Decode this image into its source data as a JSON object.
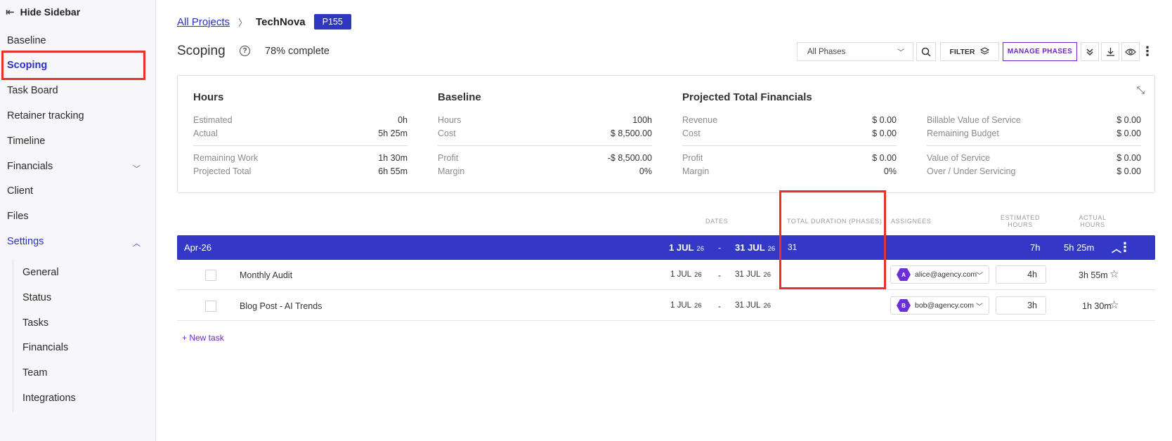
{
  "sidebar": {
    "hide_label": "Hide Sidebar",
    "items": [
      {
        "label": "Baseline"
      },
      {
        "label": "Scoping"
      },
      {
        "label": "Task Board"
      },
      {
        "label": "Retainer tracking"
      },
      {
        "label": "Timeline"
      },
      {
        "label": "Financials"
      },
      {
        "label": "Client"
      },
      {
        "label": "Files"
      },
      {
        "label": "Settings"
      }
    ],
    "settings_items": [
      {
        "label": "General"
      },
      {
        "label": "Status"
      },
      {
        "label": "Tasks"
      },
      {
        "label": "Financials"
      },
      {
        "label": "Team"
      },
      {
        "label": "Integrations"
      }
    ]
  },
  "breadcrumb": {
    "all_projects": "All Projects",
    "project": "TechNova",
    "badge": "P155"
  },
  "header": {
    "title": "Scoping",
    "complete": "78% complete",
    "phase_select": "All Phases",
    "filter_label": "FILTER",
    "manage_label": "MANAGE PHASES"
  },
  "summary": {
    "hours": {
      "title": "Hours",
      "rows1": [
        {
          "k": "Estimated",
          "v": "0h"
        },
        {
          "k": "Actual",
          "v": "5h 25m"
        }
      ],
      "rows2": [
        {
          "k": "Remaining Work",
          "v": "1h 30m"
        },
        {
          "k": "Projected Total",
          "v": "6h 55m"
        }
      ]
    },
    "baseline": {
      "title": "Baseline",
      "rows1": [
        {
          "k": "Hours",
          "v": "100h"
        },
        {
          "k": "Cost",
          "v": "$ 8,500.00"
        }
      ],
      "rows2": [
        {
          "k": "Profit",
          "v": "-$ 8,500.00"
        },
        {
          "k": "Margin",
          "v": "0%"
        }
      ]
    },
    "projected": {
      "title": "Projected Total Financials",
      "rows1": [
        {
          "k": "Revenue",
          "v": "$ 0.00"
        },
        {
          "k": "Cost",
          "v": "$ 0.00"
        }
      ],
      "rows2": [
        {
          "k": "Profit",
          "v": "$ 0.00"
        },
        {
          "k": "Margin",
          "v": "0%"
        }
      ]
    },
    "service": {
      "rows1": [
        {
          "k": "Billable Value of Service",
          "v": "$ 0.00"
        },
        {
          "k": "Remaining Budget",
          "v": "$ 0.00"
        }
      ],
      "rows2": [
        {
          "k": "Value of Service",
          "v": "$ 0.00"
        },
        {
          "k": "Over / Under Servicing",
          "v": "$ 0.00"
        }
      ]
    }
  },
  "table": {
    "headers": {
      "dates": "DATES",
      "duration": "TOTAL DURATION (PHASES)",
      "assignees": "ASSIGNEES",
      "estimated_1": "ESTIMATED",
      "estimated_2": "HOURS",
      "actual_1": "ACTUAL",
      "actual_2": "HOURS"
    },
    "phase": {
      "name": "Apr-26",
      "start": "1 JUL",
      "start_yr": "26",
      "dash": "-",
      "end": "31 JUL",
      "end_yr": "26",
      "duration": "31",
      "estimated": "7h",
      "actual": "5h 25m"
    },
    "tasks": [
      {
        "name": "Monthly Audit",
        "start": "1 JUL",
        "start_yr": "26",
        "dash": "-",
        "end": "31 JUL",
        "end_yr": "26",
        "assignee": "alice@agency.com",
        "avatar": "A",
        "estimated": "4h",
        "actual": "3h 55m"
      },
      {
        "name": "Blog Post - AI Trends",
        "start": "1 JUL",
        "start_yr": "26",
        "dash": "-",
        "end": "31 JUL",
        "end_yr": "26",
        "assignee": "bob@agency.com",
        "avatar": "B",
        "estimated": "3h",
        "actual": "1h 30m"
      }
    ],
    "new_task": "+ New task"
  },
  "colors": {
    "accent": "#2b30c8",
    "phase_bar": "#3438c6",
    "manage": "#6f25c9",
    "highlight": "#e8312a",
    "avatar": "#6b2fd6"
  }
}
